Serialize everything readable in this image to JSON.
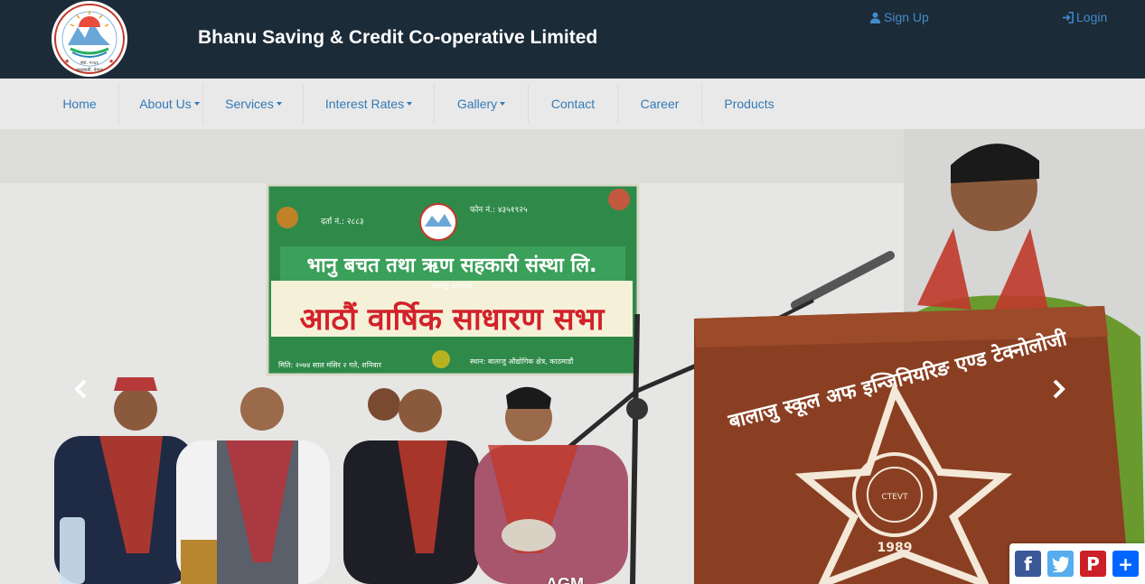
{
  "header": {
    "site_title": "Bhanu Saving & Credit Co-operative Limited",
    "signup_label": "Sign Up",
    "login_label": "Login",
    "logo_icon": "cooperative-logo-icon",
    "logo_year": "स्था. २०६६",
    "logo_place": "काठमाडौं, नेपाल"
  },
  "nav": {
    "items": [
      {
        "label": "Home",
        "dropdown": false
      },
      {
        "label": "About Us",
        "dropdown": true
      },
      {
        "label": "Services",
        "dropdown": true
      },
      {
        "label": "Interest Rates",
        "dropdown": true
      },
      {
        "label": "Gallery",
        "dropdown": true
      },
      {
        "label": "Contact",
        "dropdown": false
      },
      {
        "label": "Career",
        "dropdown": false
      },
      {
        "label": "Products",
        "dropdown": false
      }
    ]
  },
  "carousel": {
    "caption": "AGM",
    "prev_icon": "chevron-left-icon",
    "next_icon": "chevron-right-icon",
    "banner": {
      "reg_no": "दर्ता नं.: २८८३",
      "phone": "फोन नं.: ४३५१९२५",
      "org_name": "भानु बचत तथा ऋण सहकारी संस्था लि.",
      "address": "बालाजु, काठमाडौं",
      "event_name": "आठौं वार्षिक साधारण सभा",
      "date_text": "मिति: २०७४ साल मंसिर २ गते, शनिवार",
      "venue_text": "स्थान: बालाजु औद्योगिक क्षेत्र, काठमाडौं"
    },
    "podium": {
      "school_name": "बालाजु स्कूल अफ इन्जिनियरिङ एण्ड टेक्नोलोजी",
      "emblem_letters": "CTEVT",
      "emblem_year": "1989"
    }
  },
  "share": {
    "buttons": [
      {
        "name": "facebook",
        "glyph": "f",
        "color": "#3b5998"
      },
      {
        "name": "twitter",
        "glyph": "t",
        "color": "#55acee"
      },
      {
        "name": "pinterest",
        "glyph": "P",
        "color": "#cb2027"
      },
      {
        "name": "more",
        "glyph": "+",
        "color": "#0166ff"
      }
    ]
  },
  "colors": {
    "header_bg": "#1c2b38",
    "nav_bg": "#e9e9e9",
    "link": "#337ab7"
  }
}
